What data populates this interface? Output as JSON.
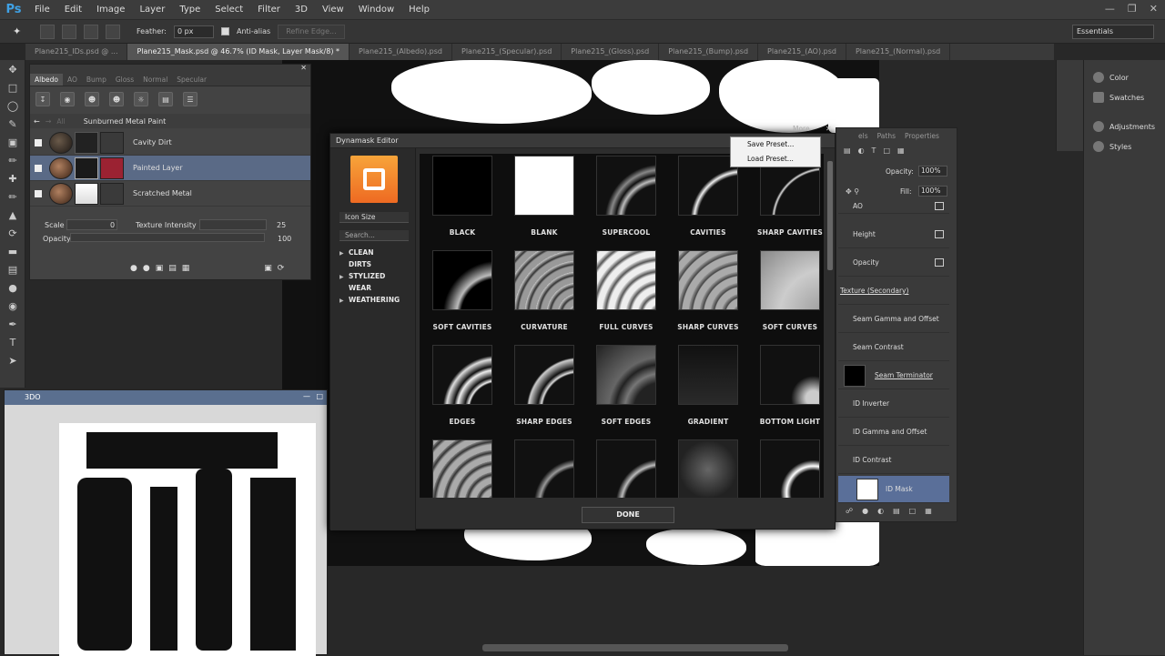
{
  "app": {
    "logo": "Ps"
  },
  "menu": [
    "File",
    "Edit",
    "Image",
    "Layer",
    "Type",
    "Select",
    "Filter",
    "3D",
    "View",
    "Window",
    "Help"
  ],
  "options_bar": {
    "feather_label": "Feather:",
    "feather_value": "0 px",
    "antialias_label": "Anti-alias",
    "refine_edge": "Refine Edge...",
    "workspace": "Essentials"
  },
  "tabs": [
    "Plane215_IDs.psd @ ...",
    "Plane215_Mask.psd @ 46.7% (ID Mask, Layer Mask/8) *",
    "Plane215_(Albedo).psd",
    "Plane215_(Specular).psd",
    "Plane215_(Gloss).psd",
    "Plane215_(Bump).psd",
    "Plane215_(AO).psd",
    "Plane215_(Normal).psd"
  ],
  "material_panel": {
    "tabs": [
      "Albedo",
      "AO",
      "Bump",
      "Gloss",
      "Normal",
      "Specular"
    ],
    "breadcrumb_all": "All",
    "material_name": "Sunburned Metal Paint",
    "layers": [
      {
        "name": "Cavity Dirt"
      },
      {
        "name": "Painted Layer"
      },
      {
        "name": "Scratched Metal"
      }
    ],
    "scale_label": "Scale",
    "scale_value": "0",
    "texture_intensity_label": "Texture Intensity",
    "texture_intensity_value": "25",
    "opacity_label": "Opacity",
    "opacity_value": "100"
  },
  "panel_3d": {
    "title": "3DO"
  },
  "dynamask": {
    "title": "Dynamask Editor",
    "more": "More",
    "icon_size": "Icon Size",
    "search_placeholder": "Search...",
    "categories": [
      "CLEAN",
      "DIRTS",
      "STYLIZED",
      "WEAR",
      "WEATHERING"
    ],
    "presets": [
      [
        "BLACK",
        "BLANK",
        "SUPERCOOL",
        "CAVITIES",
        "SHARP CAVITIES"
      ],
      [
        "SOFT CAVITIES",
        "CURVATURE",
        "FULL CURVES",
        "SHARP CURVES",
        "SOFT CURVES"
      ],
      [
        "EDGES",
        "SHARP EDGES",
        "SOFT EDGES",
        "GRADIENT",
        "BOTTOM LIGHT"
      ]
    ],
    "done": "DONE"
  },
  "context_menu": [
    "Save Preset...",
    "Load Preset..."
  ],
  "layers_panel": {
    "tabs": [
      "Paths",
      "Properties"
    ],
    "tab_cut": "els",
    "opacity_label": "Opacity:",
    "opacity_value": "100%",
    "fill_label": "Fill:",
    "fill_value": "100%",
    "rows": [
      "AO",
      "Height",
      "Opacity",
      "Texture (Secondary)",
      "Seam Gamma and Offset",
      "Seam Contrast",
      "Seam Terminator",
      "ID Inverter",
      "ID Gamma and Offset",
      "ID Contrast",
      "ID Mask"
    ]
  },
  "right_panels": [
    "Color",
    "Swatches",
    "Adjustments",
    "Styles"
  ]
}
